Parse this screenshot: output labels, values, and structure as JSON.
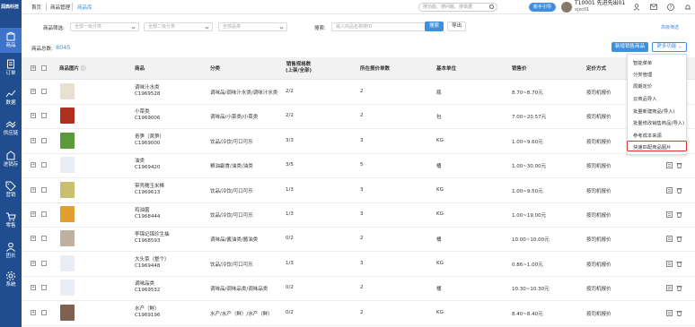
{
  "app": {
    "logo_text": "润典科技"
  },
  "sidebar": {
    "items": [
      {
        "label": "商品",
        "icon": "box-icon",
        "active": true
      },
      {
        "label": "订单",
        "icon": "order-icon"
      },
      {
        "label": "数据",
        "icon": "chart-icon"
      },
      {
        "label": "供应链",
        "icon": "supply-icon"
      },
      {
        "label": "进销存",
        "icon": "inventory-icon"
      },
      {
        "label": "营销",
        "icon": "tag-icon"
      },
      {
        "label": "零售",
        "icon": "cart-icon"
      },
      {
        "label": "团长",
        "icon": "person-icon"
      },
      {
        "label": "系统",
        "icon": "gear-icon"
      }
    ]
  },
  "breadcrumb": {
    "home": "首页",
    "section": "商品管理",
    "current": "商品库"
  },
  "header": {
    "search_placeholder": "搜功能、搜问题、搜单据",
    "new_button": "新手引导",
    "user_name": "T10001 先进先出01",
    "user_sub": "xjxc01"
  },
  "filters": {
    "label": "商品筛选:",
    "cat1_placeholder": "全部一级分类",
    "cat2_placeholder": "全部二级分类",
    "brand_placeholder": "全部品类",
    "search_label": "搜索:",
    "search_placeholder": "输入商品名称搜ID",
    "search_button": "搜索",
    "export_button": "导出",
    "advanced": "高级筛选"
  },
  "summary": {
    "label": "商品总数:",
    "value": "8045"
  },
  "toolbar": {
    "new_sale_button": "新增销售商品",
    "more_button": "更多功能"
  },
  "table": {
    "headers": {
      "image": "商品图片",
      "name": "商品",
      "category": "分类",
      "spec_count_1": "销售规格数",
      "spec_count_2": "(上架/全部)",
      "quote_count": "所在报价单数",
      "unit": "基本单位",
      "price": "销售价",
      "pricing": "定价方式"
    },
    "rows": [
      {
        "name": "调味汁水类",
        "code": "C1969528",
        "category": "调味品/调味汁水类/调味汁水类",
        "spec": "2/2",
        "quotes": "2",
        "unit": "瓶",
        "price": "8.70~8.70元",
        "pricing": "按司机报价",
        "thumb": "#e8e0d0"
      },
      {
        "name": "小菜类",
        "code": "C1969006",
        "category": "调味品/小菜类/小菜类",
        "spec": "2/2",
        "quotes": "2",
        "unit": "包",
        "price": "7.00~20.57元",
        "pricing": "按司机报价",
        "thumb": "#b03020"
      },
      {
        "name": "青笋（莴笋）",
        "code": "C1969000",
        "category": "饮品/冷饮/可口可乐",
        "spec": "3/3",
        "quotes": "3",
        "unit": "KG",
        "price": "1.00~9.60元",
        "pricing": "按司机报价",
        "thumb": "#5a9a3a"
      },
      {
        "name": "油类",
        "code": "C1969420",
        "category": "粮油副食/油类/油类",
        "spec": "3/5",
        "quotes": "5",
        "unit": "桶",
        "price": "1.00~30.00元",
        "pricing": "按司机报价",
        "thumb": "#e8eef4"
      },
      {
        "name": "带壳糯玉米棒",
        "code": "C1969613",
        "category": "饮品/冷饮/可口可乐",
        "spec": "1/3",
        "quotes": "3",
        "unit": "KG",
        "price": "1.00~9.50元",
        "pricing": "按司机报价",
        "thumb": "#c8c070"
      },
      {
        "name": "鸡油菌",
        "code": "C1968444",
        "category": "饮品/冷饮/可口可乐",
        "spec": "1/3",
        "quotes": "3",
        "unit": "KG",
        "price": "1.00~19.00元",
        "pricing": "按司机报价",
        "thumb": "#e0a030"
      },
      {
        "name": "李锦记锦珍生抽",
        "code": "C1968593",
        "category": "调味品/酱油类/酱油类",
        "spec": "0/2",
        "quotes": "2",
        "unit": "桶",
        "price": "10.00~10.00元",
        "pricing": "按司机报价",
        "thumb": "#c0b0a0"
      },
      {
        "name": "大头菜（整个）",
        "code": "C1969448",
        "category": "饮品/冷饮/可口可乐",
        "spec": "1/3",
        "quotes": "3",
        "unit": "KG",
        "price": "0.86~1.00元",
        "pricing": "按司机报价",
        "thumb": "#e8eef4"
      },
      {
        "name": "调味品类",
        "code": "C1969532",
        "category": "调味品/调味品类/调味品类",
        "spec": "0/2",
        "quotes": "2",
        "unit": "桶",
        "price": "10.30~10.30元",
        "pricing": "按司机报价",
        "thumb": "#e8eef4"
      },
      {
        "name": "水产（鲜）",
        "code": "C1969196",
        "category": "水产/水产（鲜）/水产（鲜）",
        "spec": "0/2",
        "quotes": "2",
        "unit": "KG",
        "price": "8.40~8.40元",
        "pricing": "按司机报价",
        "thumb": "#806050"
      }
    ]
  },
  "dropdown": {
    "items": [
      "智能菜单",
      "分类管理",
      "周期定价",
      "云商品导入",
      "批量新建商品(导入)",
      "批量修改销售商品(导入)",
      "参考成本来源",
      "快速匹配商品图片"
    ],
    "highlighted_index": 7
  },
  "colors": {
    "sidebar": "#1f4d8f",
    "accent": "#3d8fe0",
    "highlight": "#e03030"
  }
}
